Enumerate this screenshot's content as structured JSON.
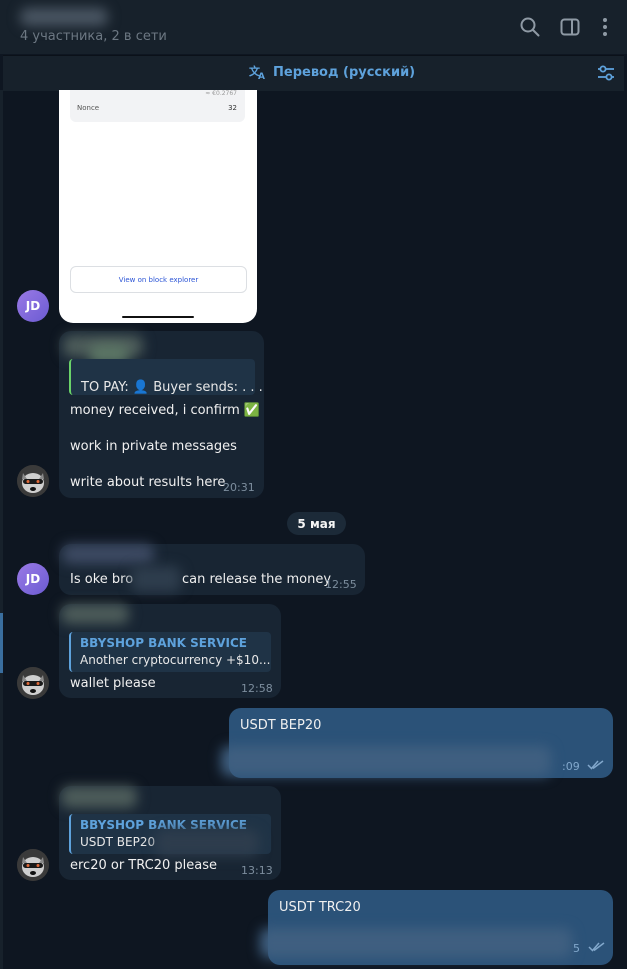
{
  "header": {
    "subtitle": "4 участника, 2 в сети",
    "icons": [
      "search-icon",
      "sidebar-icon",
      "more-vertical-icon"
    ]
  },
  "translate_bar": {
    "label": "Перевод (русский)",
    "icon": "translate-icon",
    "settings_icon": "filter-icon"
  },
  "screenshot": {
    "eur_value": "≈ €0.2767",
    "nonce_label": "Nonce",
    "nonce_value": "32",
    "explorer_button": "View on block explorer"
  },
  "messages": [
    {
      "avatar": "JD"
    },
    {
      "preview": "TO PAY: 👤 Buyer sends: . . .",
      "lines": [
        "money received, i confirm ✅",
        "work in private messages",
        "write about results here"
      ],
      "time": "20:31"
    },
    {
      "date": "5 мая"
    },
    {
      "avatar": "JD",
      "text_before": "Is oke bro",
      "text_after": "can release the money",
      "time": "12:55"
    },
    {
      "reply_name": "BBYSHOP BANK SERVICE",
      "reply_text": "Another cryptocurrency +$10...",
      "text": "wallet please",
      "time": "12:58"
    },
    {
      "text": "USDT BEP20",
      "time": ":09"
    },
    {
      "reply_name": "BBYSHOP BANK SERVICE",
      "reply_text": "USDT BEP20",
      "text": "erc20 or TRC20 please",
      "time": "13:13"
    },
    {
      "text": "USDT TRC20",
      "time": "5"
    }
  ],
  "colors": {
    "background": "#0e1621",
    "incoming_bubble": "#182533",
    "outgoing_bubble": "#2b5278",
    "accent": "#5ea2dc"
  }
}
